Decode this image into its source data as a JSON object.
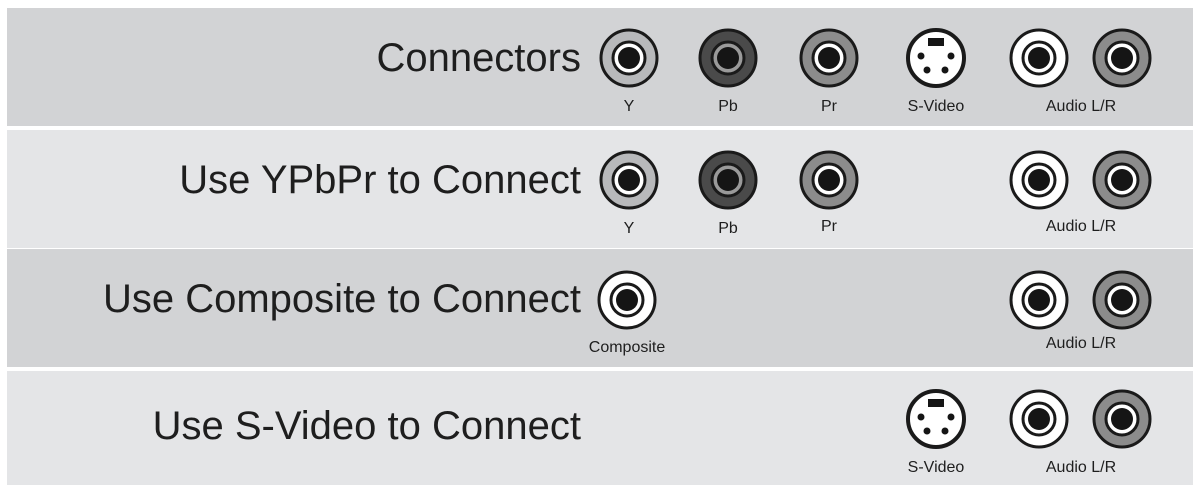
{
  "rows": [
    {
      "title": "Connectors",
      "labels": {
        "y": "Y",
        "pb": "Pb",
        "pr": "Pr",
        "svideo": "S-Video",
        "audio": "Audio L/R"
      }
    },
    {
      "title": "Use YPbPr to Connect",
      "labels": {
        "y": "Y",
        "pb": "Pb",
        "pr": "Pr",
        "audio": "Audio L/R"
      }
    },
    {
      "title": "Use Composite to Connect",
      "labels": {
        "composite": "Composite",
        "audio": "Audio L/R"
      }
    },
    {
      "title": "Use S-Video to Connect",
      "labels": {
        "svideo": "S-Video",
        "audio": "Audio L/R"
      }
    }
  ],
  "colors": {
    "row_dark": "#d2d3d5",
    "row_light": "#e4e5e7",
    "jack_y": "#b8b9bb",
    "jack_pb": "#4a4a4a",
    "jack_pr": "#8c8c8c",
    "jack_white": "#ffffff",
    "jack_audio_r": "#8c8c8c"
  }
}
